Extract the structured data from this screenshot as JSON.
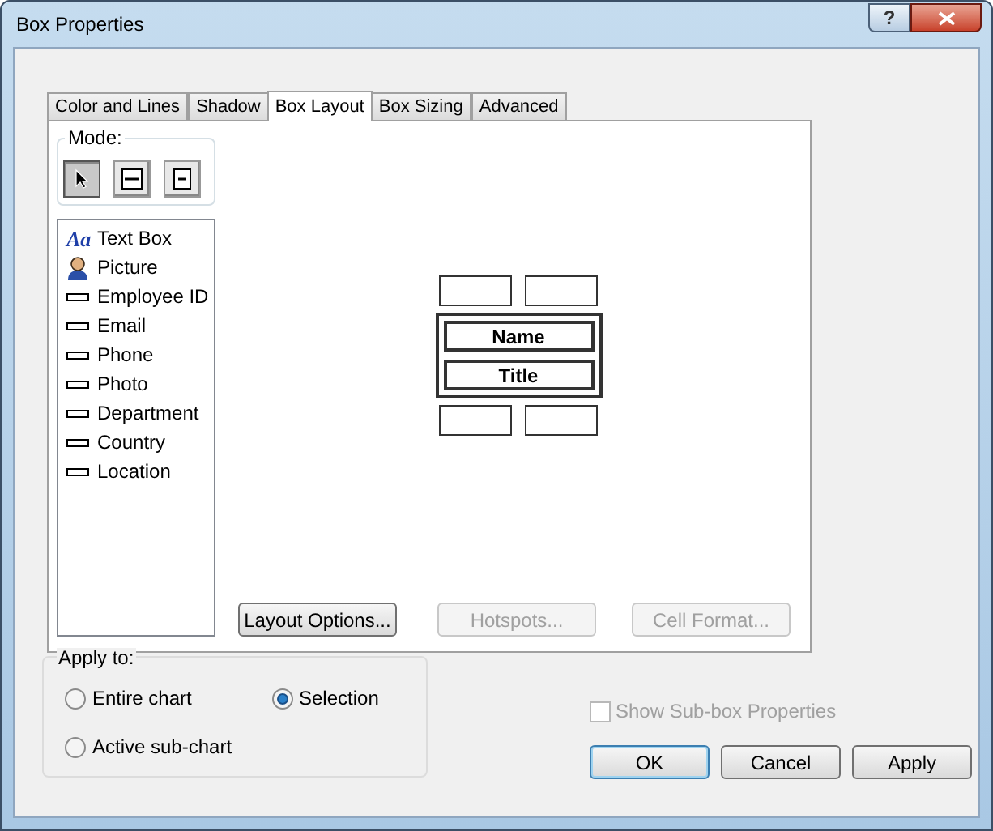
{
  "window": {
    "title": "Box Properties",
    "help_glyph": "?"
  },
  "tabs": [
    {
      "label": "Color and Lines",
      "selected": false
    },
    {
      "label": "Shadow",
      "selected": false
    },
    {
      "label": "Box Layout",
      "selected": true
    },
    {
      "label": "Box Sizing",
      "selected": false
    },
    {
      "label": "Advanced",
      "selected": false
    }
  ],
  "mode": {
    "label": "Mode:",
    "buttons": [
      {
        "kind": "pointer",
        "selected": true
      },
      {
        "kind": "box-line",
        "selected": false
      },
      {
        "kind": "box-small",
        "selected": false
      }
    ]
  },
  "element_list": [
    {
      "kind": "text",
      "glyph": "Aa",
      "label": "Text Box"
    },
    {
      "kind": "picture",
      "label": "Picture"
    },
    {
      "kind": "field",
      "label": "Employee ID"
    },
    {
      "kind": "field",
      "label": "Email"
    },
    {
      "kind": "field",
      "label": "Phone"
    },
    {
      "kind": "field",
      "label": "Photo"
    },
    {
      "kind": "field",
      "label": "Department"
    },
    {
      "kind": "field",
      "label": "Country"
    },
    {
      "kind": "field",
      "label": "Location"
    }
  ],
  "layout_preview": {
    "fields": [
      "Name",
      "Title"
    ]
  },
  "panel_buttons": [
    {
      "label": "Layout Options...",
      "disabled": false
    },
    {
      "label": "Hotspots...",
      "disabled": true
    },
    {
      "label": "Cell Format...",
      "disabled": true
    }
  ],
  "apply_to": {
    "label": "Apply to:",
    "options": [
      {
        "label": "Entire chart",
        "selected": false
      },
      {
        "label": "Selection",
        "selected": true
      },
      {
        "label": "Active sub-chart",
        "selected": false
      }
    ]
  },
  "show_subbox": {
    "label": "Show Sub-box Properties",
    "checked": false,
    "disabled": true
  },
  "buttons": [
    {
      "label": "OK",
      "default": true
    },
    {
      "label": "Cancel",
      "default": false
    },
    {
      "label": "Apply",
      "default": false
    }
  ]
}
